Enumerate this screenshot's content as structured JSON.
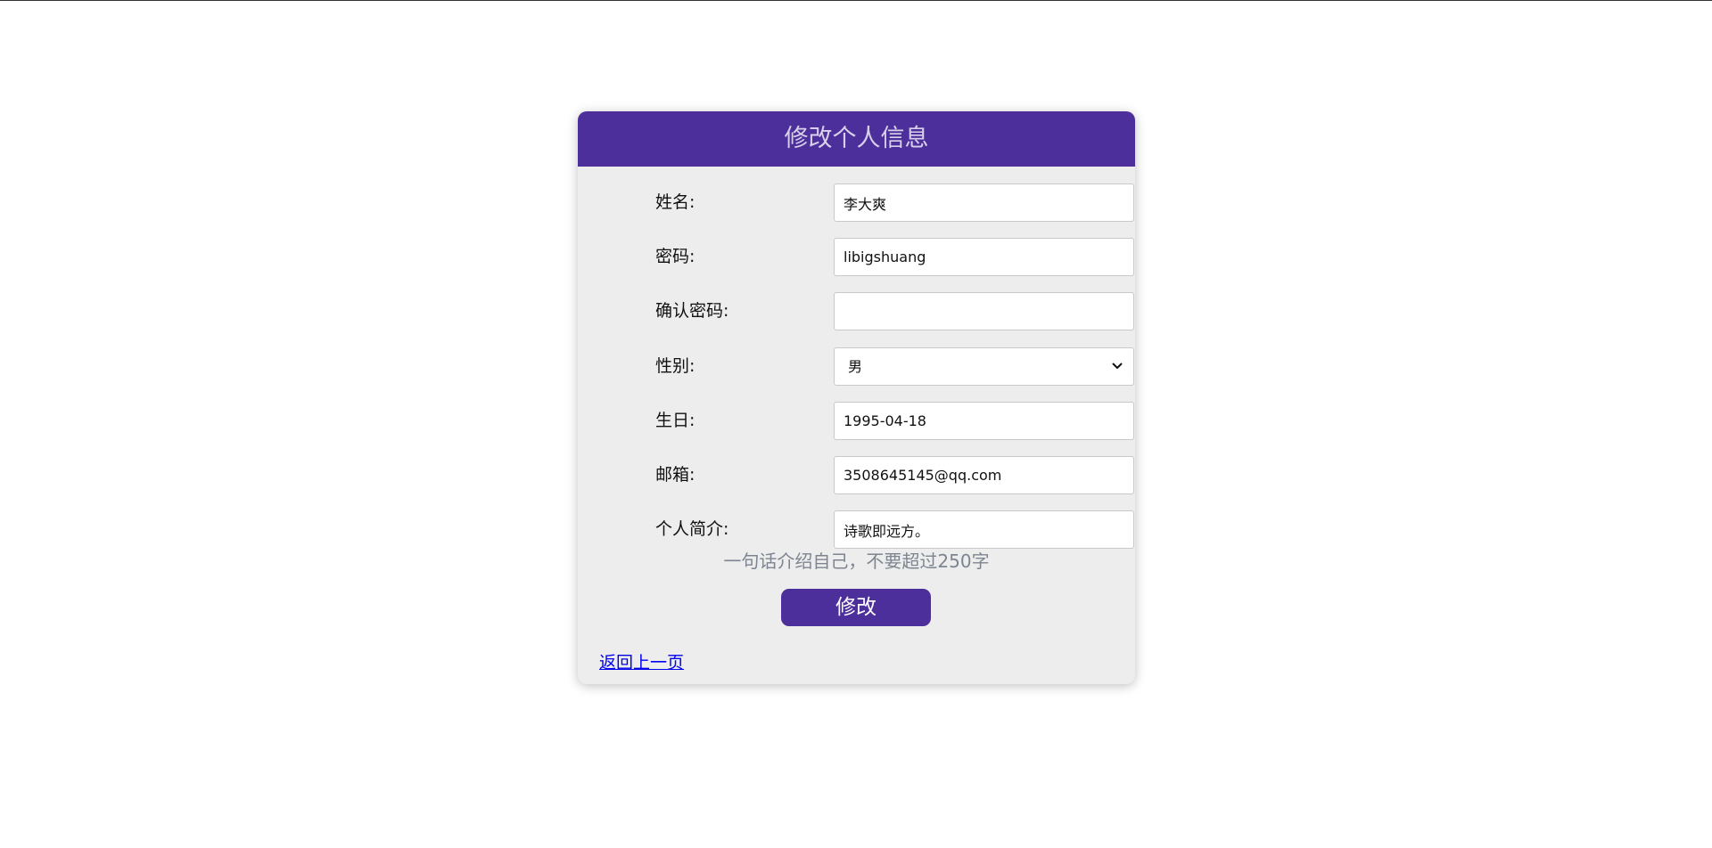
{
  "header": {
    "title": "修改个人信息"
  },
  "form": {
    "name": {
      "label": "姓名:",
      "value": "李大爽"
    },
    "password": {
      "label": "密码:",
      "value": "libigshuang"
    },
    "confirm_password": {
      "label": "确认密码:",
      "value": ""
    },
    "gender": {
      "label": "性别:",
      "value": "男"
    },
    "birthday": {
      "label": "生日:",
      "value": "1995-04-18"
    },
    "email": {
      "label": "邮箱:",
      "value": "3508645145@qq.com"
    },
    "bio": {
      "label": "个人简介:",
      "value": "诗歌即远方。"
    },
    "hint": "一句话介绍自己，不要超过250字",
    "submit_label": "修改",
    "back_link": "返回上一页"
  },
  "colors": {
    "accent": "#4d2f9b",
    "card_bg": "#ededed",
    "hint": "#7d8591"
  },
  "icons": {
    "select_arrow": "chevron-down-icon"
  }
}
